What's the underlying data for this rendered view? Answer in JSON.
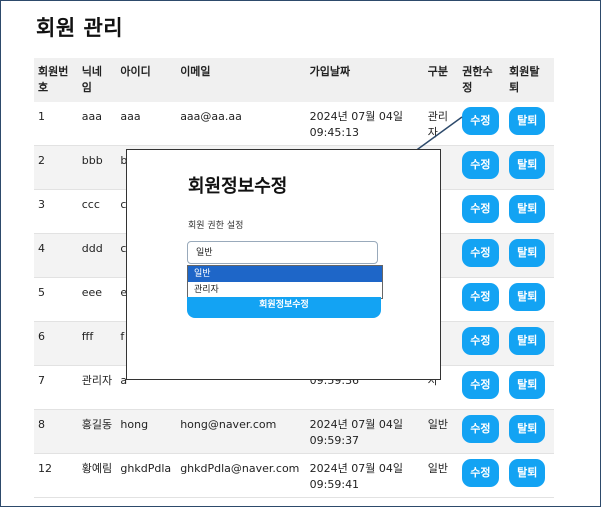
{
  "page": {
    "title": "회원 관리"
  },
  "table": {
    "headers": [
      "회원번호",
      "닉네임",
      "아이디",
      "이메일",
      "가입날짜",
      "구분",
      "권한수정",
      "회원탈퇴"
    ],
    "header_lines": [
      [
        "회원번",
        "호"
      ],
      [
        "닉네",
        "임"
      ],
      [
        "아이디"
      ],
      [
        "이메일"
      ],
      [
        "가입날짜"
      ],
      [
        "구분"
      ],
      [
        "권한수",
        "정"
      ],
      [
        "회원탈",
        "퇴"
      ]
    ],
    "rows": [
      {
        "id": "1",
        "nick": "aaa",
        "user": "aaa",
        "email": "aaa@aa.aa",
        "date": "2024년 07월 04일",
        "time": "09:45:13",
        "role": "관리자"
      },
      {
        "id": "2",
        "nick": "bbb",
        "user": "b",
        "email": "",
        "date": "",
        "time": "",
        "role": "리"
      },
      {
        "id": "3",
        "nick": "ccc",
        "user": "c",
        "email": "",
        "date": "",
        "time": "",
        "role": "반"
      },
      {
        "id": "4",
        "nick": "ddd",
        "user": "c",
        "email": "",
        "date": "",
        "time": "",
        "role": "반"
      },
      {
        "id": "5",
        "nick": "eee",
        "user": "e",
        "email": "",
        "date": "",
        "time": "",
        "role": "리"
      },
      {
        "id": "6",
        "nick": "fff",
        "user": "f",
        "email": "",
        "date": "",
        "time": "",
        "role": "반"
      },
      {
        "id": "7",
        "nick": "관리자",
        "user": "a",
        "email": "",
        "date": "",
        "time": "09:59:36",
        "role": "자"
      },
      {
        "id": "8",
        "nick": "홍길동",
        "user": "hong",
        "email": "hong@naver.com",
        "date": "2024년 07월 04일",
        "time": "09:59:37",
        "role": "일반"
      },
      {
        "id": "12",
        "nick": "황예림",
        "user": "ghkdPdla",
        "email": "ghkdPdla@naver.com",
        "date": "2024년 07월 04일",
        "time": "09:59:41",
        "role": "일반"
      }
    ],
    "edit_label": "수정",
    "delete_label": "탈퇴"
  },
  "modal": {
    "title": "회원정보수정",
    "label": "회원 권한 설정",
    "select_value": "일반",
    "options": [
      "일반",
      "관리자"
    ],
    "selected_option": "일반",
    "submit_label": "회원정보수정"
  },
  "colors": {
    "accent": "#13a3f3",
    "frame": "#2d4a6b",
    "option_highlight": "#1e66c8"
  }
}
